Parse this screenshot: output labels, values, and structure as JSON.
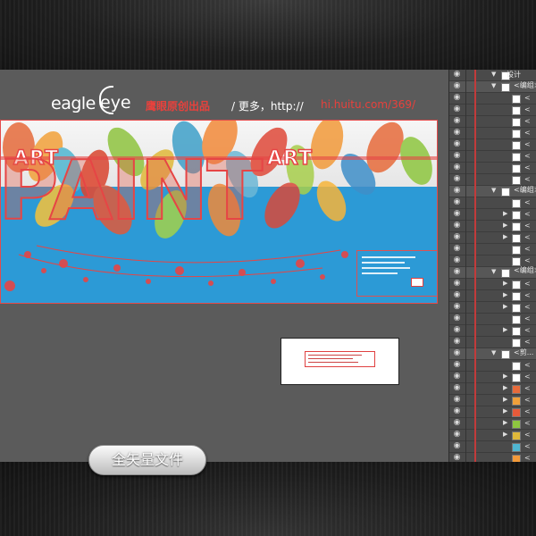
{
  "header": {
    "logo_part1": "eagle",
    "logo_part2": "eye",
    "brand_text": "鹰眼原创出品",
    "more_text": "/ 更多，http://",
    "url_text": "hi.huitu.com/369/"
  },
  "artwork": {
    "title_word": "PAINT",
    "side_word": "ART"
  },
  "layers_panel": {
    "top_layer": "设计",
    "groups": [
      "<编组>",
      "<编组>",
      "<编组>",
      "<编组>",
      "<剪..."
    ],
    "item_marker": "<"
  },
  "button": {
    "label": "全矢量文件"
  },
  "colors": {
    "accent_red": "#e8413c",
    "art_blue": "#2c9ad6",
    "canvas_gray": "#5b5b5b"
  },
  "icons": [
    "eye-icon",
    "expand-arrow-icon",
    "layer-thumbnail"
  ]
}
